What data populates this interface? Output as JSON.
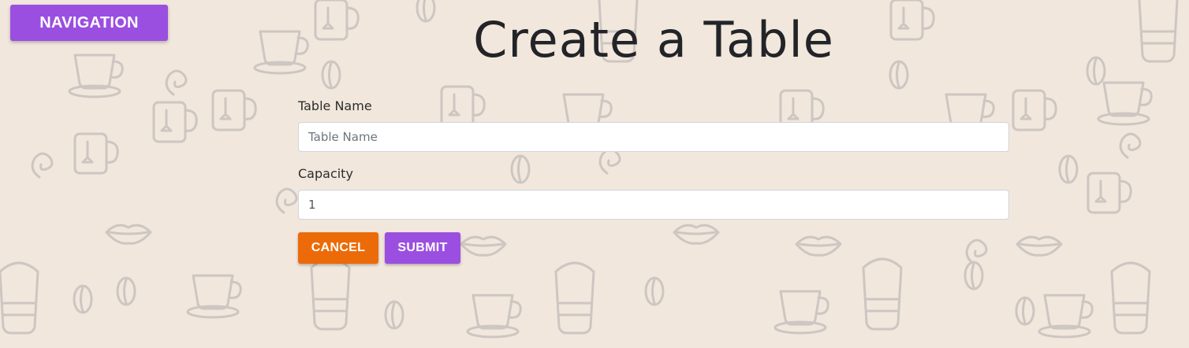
{
  "nav": {
    "label": "NAVIGATION"
  },
  "page": {
    "title": "Create a Table"
  },
  "form": {
    "name_label": "Table Name",
    "name_placeholder": "Table Name",
    "name_value": "",
    "capacity_label": "Capacity",
    "capacity_value": "1",
    "cancel_label": "CANCEL",
    "submit_label": "SUBMIT"
  },
  "colors": {
    "background": "#f1e7dc",
    "doodle": "#cdc6c2",
    "accent_purple": "#9b4fe0",
    "accent_orange": "#ec6b08"
  },
  "background_pattern": "coffee-doodle-pattern"
}
